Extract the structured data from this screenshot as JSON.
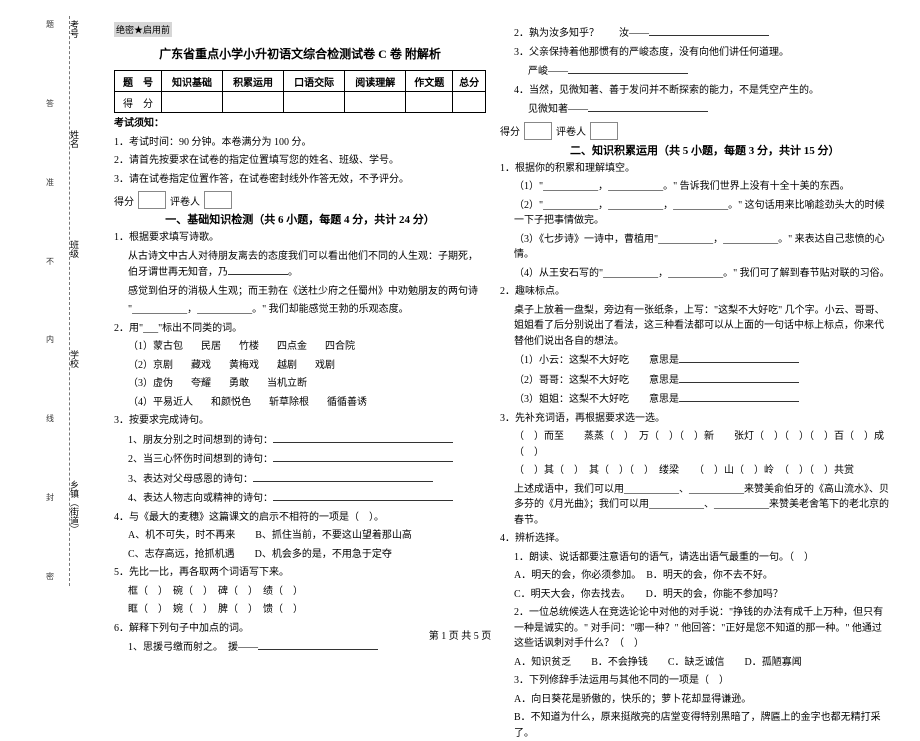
{
  "meta": {
    "secret": "绝密★启用前",
    "title": "广东省重点小学小升初语文综合检测试卷 C 卷 附解析",
    "footer": "第 1 页 共 5 页"
  },
  "binding": {
    "fields": [
      "考号",
      "姓名",
      "班级",
      "学校",
      "乡镇（街道）"
    ],
    "notes": [
      "题",
      "答",
      "准",
      "不",
      "内",
      "线",
      "封",
      "密"
    ]
  },
  "score_table": {
    "row1": [
      "题　号",
      "知识基础",
      "积累运用",
      "口语交际",
      "阅读理解",
      "作文题",
      "总分"
    ],
    "row2_label": "得　分"
  },
  "instructions": {
    "heading": "考试须知：",
    "items": [
      "1．考试时间：90 分钟。本卷满分为 100 分。",
      "2．请首先按要求在试卷的指定位置填写您的姓名、班级、学号。",
      "3．请在试卷指定位置作答，在试卷密封线外作答无效，不予评分。"
    ]
  },
  "mark": {
    "a": "得分",
    "b": "评卷人"
  },
  "part1": {
    "title": "一、基础知识检测（共 6 小题，每题 4 分，共计 24 分）",
    "q1a": "1．根据要求填写诗歌。",
    "q1b": "从古诗文中古人对待朋友离去的态度我们可以看出他们不同的人生观：子期死，伯牙谓世再无知音，乃",
    "q1c": "感觉到伯牙的消极人生观；而王勃在《送杜少府之任蜀州》中劝勉朋友的两句诗",
    "q1d": "\"___________，___________。\" 我们却能感觉王勃的乐观态度。",
    "q2": "2．用\"___\"标出不同类的词。",
    "q2rows": [
      [
        "（1）蒙古包",
        "民居",
        "竹楼",
        "四点金",
        "四合院"
      ],
      [
        "（2）京剧",
        "藏戏",
        "黄梅戏",
        "越剧",
        "戏剧"
      ],
      [
        "（3）虚伪",
        "夸耀",
        "勇敢",
        "当机立断"
      ],
      [
        "（4）平易近人",
        "和颜悦色",
        "斩草除根",
        "循循善诱"
      ]
    ],
    "q3": "3．按要求完成诗句。",
    "q3rows": [
      "1、朋友分别之时间想到的诗句：",
      "2、当三心怀伤时间想到的诗句：",
      "3、表达对父母感恩的诗句：",
      "4、表达人物志向或精神的诗句："
    ],
    "q4": "4．与《最大的麦穗》这篇课文的启示不相符的一项是（　）。",
    "q4opts": [
      "A、机不可失，时不再来　　B、抓住当前，不要这山望着那山高",
      "C、志存高远，抢抓机遇　　D、机会多的是，不用急于定夺"
    ],
    "q5": "5．先比一比，再各取两个词语写下来。",
    "q5rows": [
      "框（　）　碗（　）　碑（　）　绩（　）",
      "眶（　）　婉（　）　脾（　）　馈（　）"
    ],
    "q6": "6．解释下列句子中加点的词。",
    "q6a": "1、思援弓缴而射之。　援——"
  },
  "rightcol": {
    "r1": "2．孰为汝多知乎？　　汝——",
    "r2": "3．父亲保持着他那惯有的严峻态度，没有向他们讲任何道理。",
    "r2a": "严峻——",
    "r3": "4．当然，见微知著、善于发问并不断探索的能力，不是凭空产生的。",
    "r3a": "见微知著——"
  },
  "part2": {
    "title": "二、知识积累运用（共 5 小题，每题 3 分，共计 15 分）",
    "q1": "1．根据你的积累和理解填空。",
    "q1rows": [
      "（1）\"___________，___________。\" 告诉我们世界上没有十全十美的东西。",
      "（2）\"___________，___________，___________。\" 这句话用来比喻趁劲头大的时候一下子把事情做完。",
      "（3）《七步诗》一诗中，曹植用\"___________，___________。\" 来表达自己悲愤的心情。",
      "（4）从王安石写的\"___________，___________。\" 我们可了解到春节贴对联的习俗。"
    ],
    "q2": "2．趣味标点。",
    "q2text": "桌子上放着一盘梨，旁边有一张纸条，上写：\"这梨不大好吃\" 几个字。小云、哥哥、姐姐看了后分别说出了看法，这三种看法都可以从上面的一句话中标上标点，你来代替他们说出各自的想法。",
    "q2rows": [
      "（1）小云：这梨不大好吃　　意思是",
      "（2）哥哥：这梨不大好吃　　意思是",
      "（3）姐姐：这梨不大好吃　　意思是"
    ],
    "q3": "3．先补充词语，再根据要求选一选。",
    "q3rows": [
      "（　）而至　　蒸蒸（　）　万（　）（　）新　　张灯（　）（　）（　）百（　）成（　）",
      "（　）其（　）　其（　）（　）　缕梁　　（　）山（　）岭　（　）（　）共赏"
    ],
    "q3b": "上述成语中，我们可以用___________、___________来赞美俞伯牙的《高山流水》、贝多芬的《月光曲》；我们可以用___________、___________来赞美老舍笔下的老北京的春节。",
    "q4": "4．辨析选择。",
    "q4rows": [
      "1．朗读、说话都要注意语句的语气，请选出语气最重的一句。（　）",
      "A．明天的会，你必须参加。　B．明天的会，你不去不好。",
      "C．明天大会，你去找去。　　D．明天的会，你能不参加吗？",
      "2．一位总统候选人在竞选论论中对他的对手说：\"挣钱的办法有成千上万种，但只有一种是诚实的。\" 对手问：\"哪一种？\" 他回答：\"正好是您不知道的那一种。\" 他通过这些话讽刺对手什么？（　）",
      "A．知识贫乏　　B．不会挣钱　　C．缺乏诚信　　D．孤陋寡闻",
      "3．下列修辞手法运用与其他不同的一项是（　）",
      "A．向日葵花是骄傲的，快乐的；萝卜花却显得谦逊。",
      "B．不知道为什么，原来挺敞亮的店堂变得特别黑暗了，牌匾上的金字也都无精打采了。"
    ]
  }
}
